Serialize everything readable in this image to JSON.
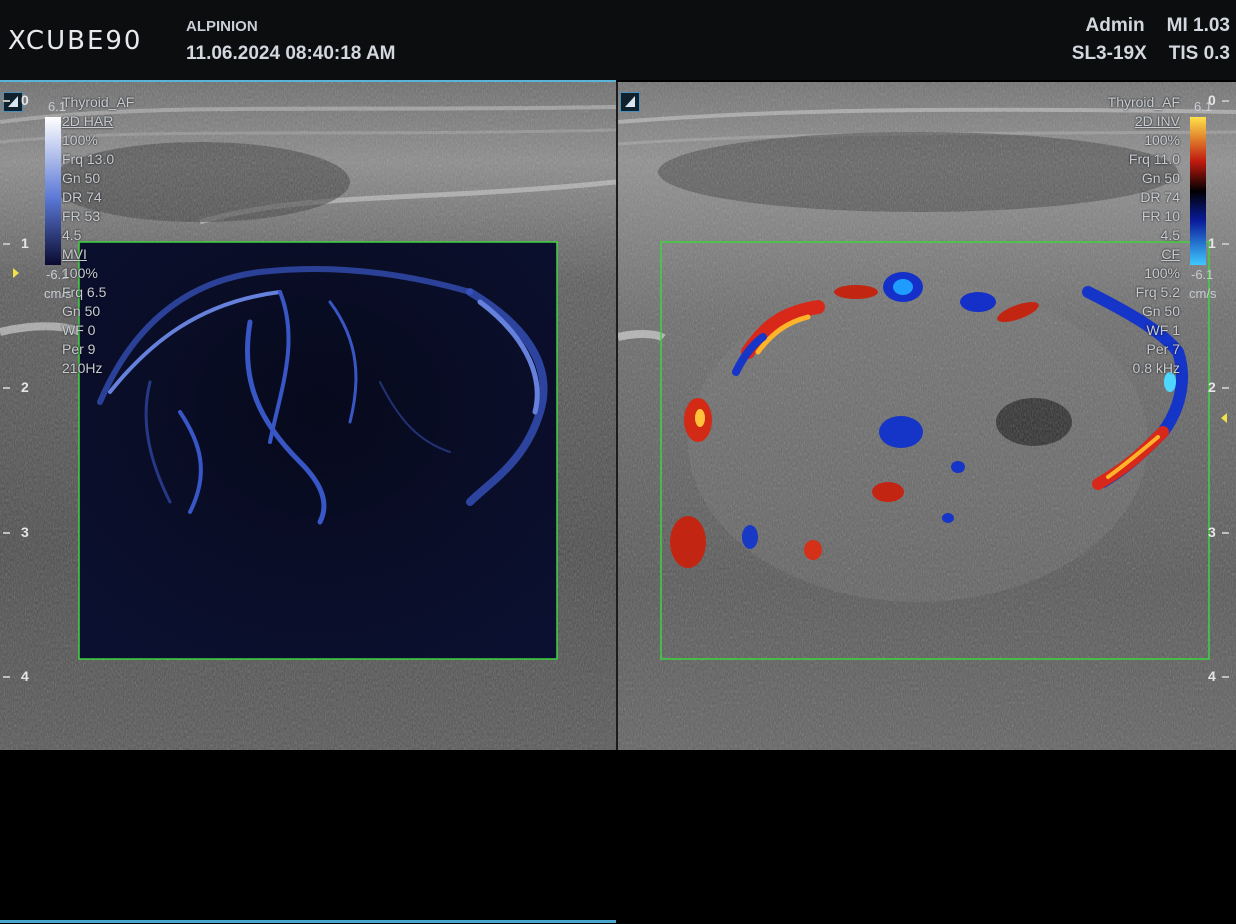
{
  "header": {
    "logo": "XCUBE90",
    "vendor": "ALPINION",
    "datetime": "11.06.2024  08:40:18 AM",
    "user": "Admin",
    "mi": "MI 1.03",
    "probe": "SL3-19X",
    "tis": "TIS 0.3"
  },
  "left_image": {
    "preset": "Thyroid_AF",
    "params": [
      "2D HAR",
      "100%",
      "Frq 13.0",
      "Gn 50",
      "DR 74",
      "FR 53",
      "4.5"
    ],
    "flow_mode": "MVI",
    "flow_params": [
      "100%",
      "Frq 6.5",
      "Gn 50",
      "WF 0",
      "Per 9",
      "210Hz"
    ],
    "colorbar_top": "6.1",
    "colorbar_bottom": "-6.1",
    "colorbar_unit": "cm/s",
    "colorbar_colors": [
      "#ffffff",
      "#5a78d6",
      "#0a0a30"
    ]
  },
  "right_image": {
    "preset": "Thyroid_AF",
    "params": [
      "2D INV",
      "100%",
      "Frq 11.0",
      "Gn 50",
      "DR 74",
      "FR 10",
      "4.5"
    ],
    "flow_mode": "CF",
    "flow_params": [
      "100%",
      "Frq 5.2",
      "Gn 50",
      "WF 1",
      "Per 7",
      "0.8 kHz"
    ],
    "colorbar_top": "6.1",
    "colorbar_bottom": "-6.1",
    "colorbar_unit": "cm/s",
    "colorbar_colors": [
      "#ffe24a",
      "#c01a10",
      "#000000",
      "#0a1a9a",
      "#3fc8ff"
    ]
  },
  "depth_scale": {
    "labels": [
      "0",
      "1",
      "2",
      "3",
      "4"
    ],
    "unit": "cm"
  },
  "colors": {
    "roi_box": "#3ed43e",
    "accent": "#5ab4d8"
  }
}
